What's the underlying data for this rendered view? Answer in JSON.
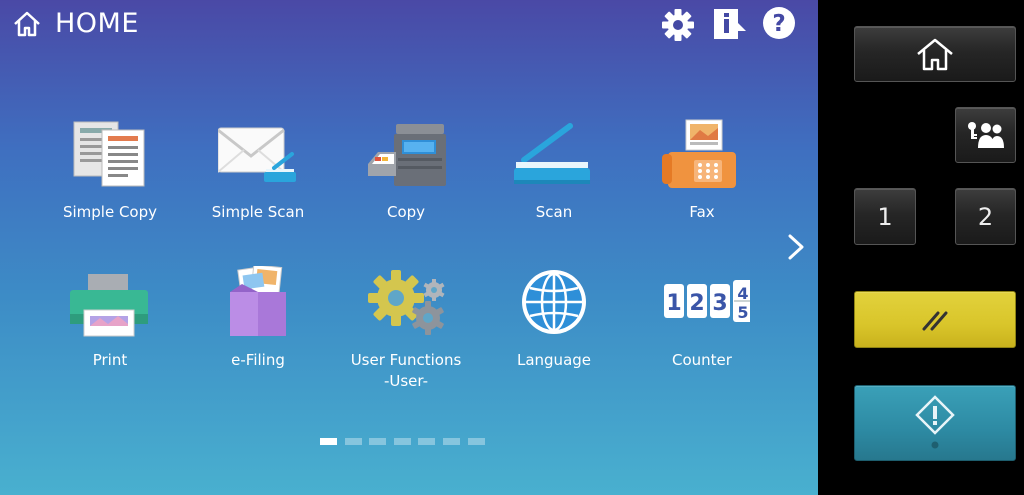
{
  "header": {
    "title": "HOME",
    "icons": [
      "home-icon",
      "gear-icon",
      "info-icon",
      "help-icon"
    ]
  },
  "tiles": [
    {
      "label": "Simple Copy",
      "icon": "simple-copy-icon"
    },
    {
      "label": "Simple Scan",
      "icon": "simple-scan-icon"
    },
    {
      "label": "Copy",
      "icon": "copier-icon"
    },
    {
      "label": "Scan",
      "icon": "scanner-icon"
    },
    {
      "label": "Fax",
      "icon": "fax-icon"
    },
    {
      "label": "Print",
      "icon": "printer-icon"
    },
    {
      "label": "e-Filing",
      "icon": "e-filing-box-icon"
    },
    {
      "label": "User Functions\n-User-",
      "label_line1": "User Functions",
      "label_line2": "-User-",
      "icon": "gears-icon"
    },
    {
      "label": "Language",
      "icon": "globe-icon"
    },
    {
      "label": "Counter",
      "icon": "counter-digits-icon",
      "digits": [
        "1",
        "2",
        "3",
        "4",
        "5"
      ]
    }
  ],
  "pager": {
    "pages": 7,
    "current": 1
  },
  "hardware_panel": {
    "buttons": [
      {
        "name": "home",
        "icon": "home-icon"
      },
      {
        "name": "user-access",
        "icon": "users-key-icon"
      },
      {
        "name": "one",
        "label": "1"
      },
      {
        "name": "two",
        "label": "2"
      },
      {
        "name": "reset",
        "icon": "reset-slash-icon",
        "color": "#dccb30"
      },
      {
        "name": "start",
        "icon": "start-diamond-icon",
        "color": "#2f8ca5"
      }
    ]
  },
  "colors": {
    "screen_top": "#4a49a6",
    "screen_bottom": "#49b0cf",
    "reset_yellow": "#dccb30",
    "start_teal": "#2f8ca5"
  }
}
